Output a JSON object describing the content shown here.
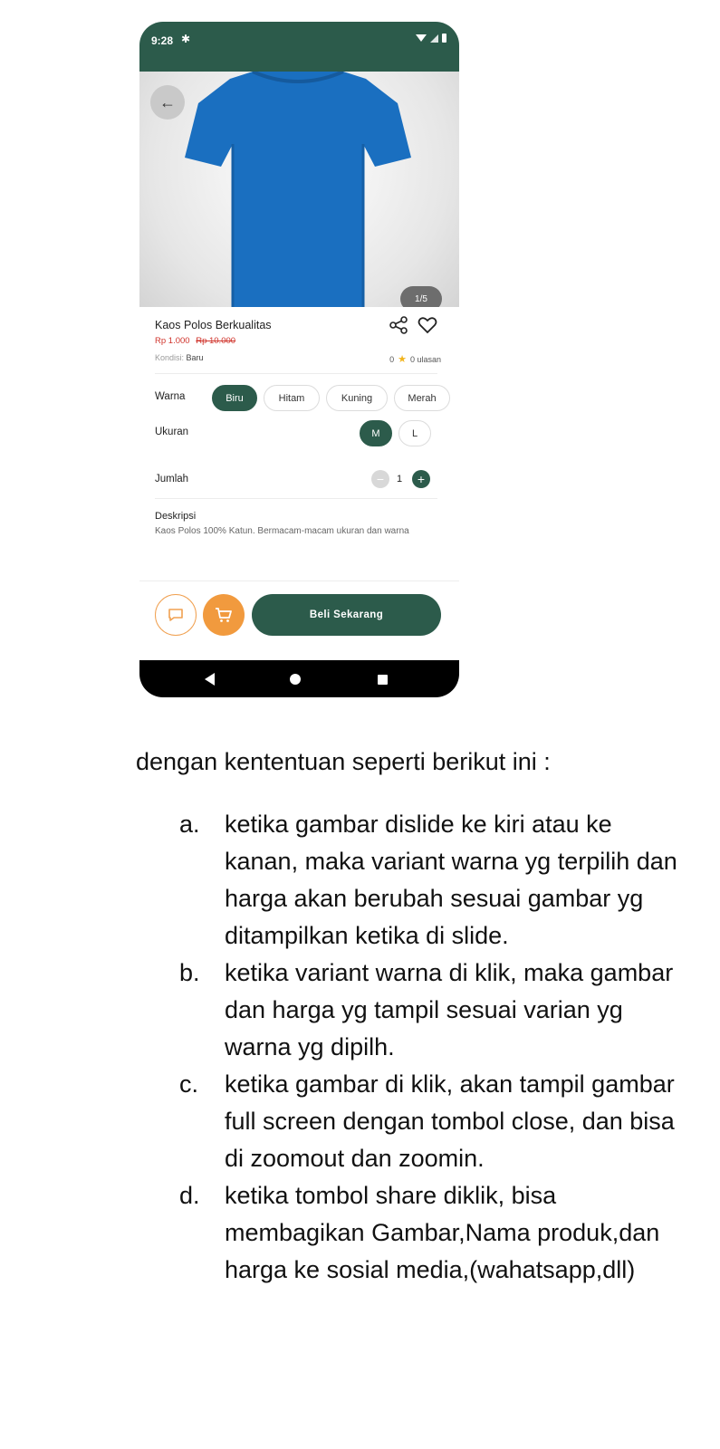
{
  "status_bar": {
    "time": "9:28"
  },
  "hero": {
    "counter": "1/5"
  },
  "product": {
    "name": "Kaos Polos Berkualitas",
    "price": "Rp 1.000",
    "price_old": "Rp 10.000",
    "condition_label": "Kondisi:",
    "condition_value": "Baru",
    "rating": "0",
    "reviews": "0 ulasan"
  },
  "variants": {
    "color_label": "Warna",
    "colors": [
      "Biru",
      "Hitam",
      "Kuning",
      "Merah"
    ],
    "selected_color": "Biru",
    "size_label": "Ukuran",
    "sizes": [
      "M",
      "L"
    ],
    "selected_size": "M"
  },
  "quantity": {
    "label": "Jumlah",
    "value": "1"
  },
  "description": {
    "title": "Deskripsi",
    "text": "Kaos Polos 100% Katun. Bermacam-macam ukuran dan warna"
  },
  "actions": {
    "buy_label": "Beli Sekarang"
  },
  "colors": {
    "primary": "#2c5b4b",
    "accent": "#f19a3e",
    "price": "#d0342c",
    "shirt": "#1a6fc0"
  },
  "icons": [
    "back-arrow-icon",
    "settings-icon",
    "wifi-icon",
    "signal-icon",
    "battery-icon",
    "share-icon",
    "heart-icon",
    "star-icon",
    "chat-icon",
    "cart-icon"
  ],
  "instructions": {
    "title": "dengan kententuan seperti berikut ini :",
    "items": [
      {
        "marker": "a.",
        "text": "ketika gambar dislide ke kiri atau ke kanan, maka variant warna yg terpilih dan harga akan berubah sesuai gambar yg ditampilkan ketika di slide."
      },
      {
        "marker": "b.",
        "text": "ketika variant warna di klik, maka gambar dan harga yg tampil sesuai varian yg warna yg dipilh."
      },
      {
        "marker": "c.",
        "text": "ketika gambar di klik, akan tampil gambar full screen dengan tombol close, dan bisa di zoomout dan zoomin."
      },
      {
        "marker": "d.",
        "text": "ketika tombol share diklik, bisa membagikan Gambar,Nama produk,dan harga ke sosial media,(wahatsapp,dll)"
      }
    ]
  }
}
